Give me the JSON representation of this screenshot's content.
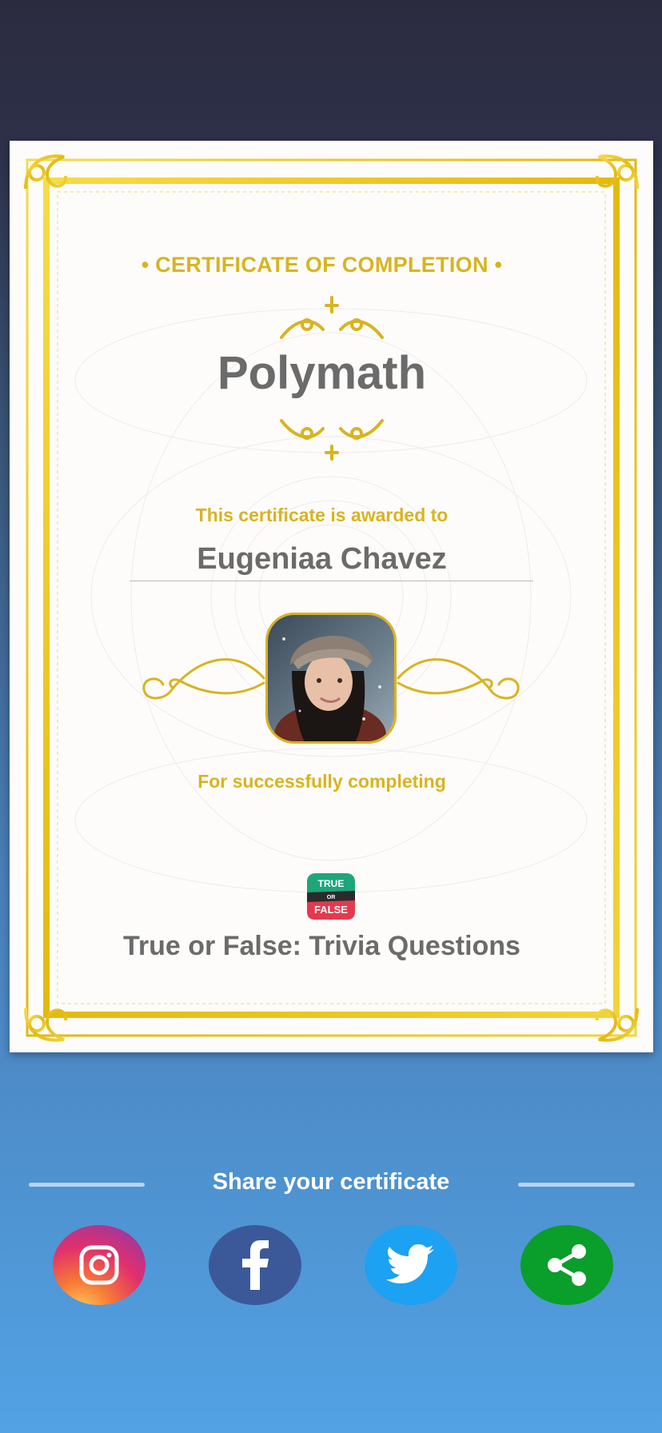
{
  "certificate": {
    "eyebrow": "• CERTIFICATE OF COMPLETION •",
    "title": "Polymath",
    "awarded_label": "This certificate is awarded to",
    "recipient_name": "Eugeniaa Chavez",
    "completing_label": "For successfully completing",
    "app_logo": {
      "top": "TRUE",
      "middle": "OR",
      "bottom": "FALSE"
    },
    "app_name": "True or False: Trivia Questions"
  },
  "share": {
    "title": "Share your certificate",
    "buttons": [
      {
        "name": "instagram",
        "icon": "instagram-icon",
        "color": "#e1306c"
      },
      {
        "name": "facebook",
        "icon": "facebook-icon",
        "color": "#3b5998"
      },
      {
        "name": "twitter",
        "icon": "twitter-icon",
        "color": "#1da1f2"
      },
      {
        "name": "share",
        "icon": "share-icon",
        "color": "#0a9e2a"
      }
    ]
  },
  "colors": {
    "gold": "#d9b320",
    "text_gray": "#6b6b6b"
  }
}
